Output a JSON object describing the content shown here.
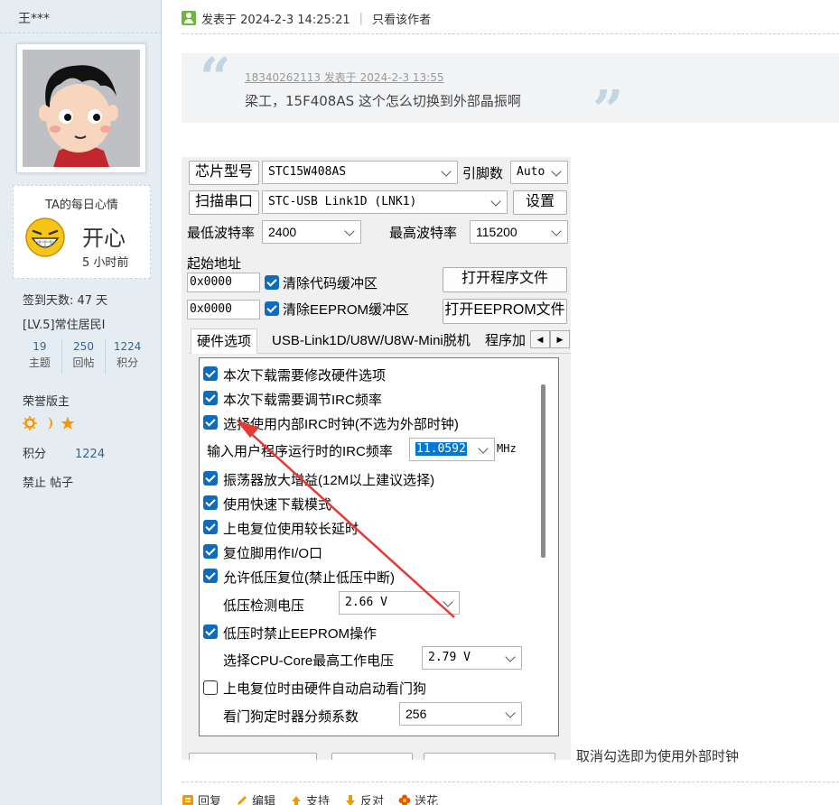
{
  "sidebar": {
    "username": "王***",
    "mood": {
      "title": "TA的每日心情",
      "text": "开心",
      "time": "5 小时前"
    },
    "signin_days": "签到天数: 47 天",
    "level": "[LV.5]常住居民I",
    "stats": [
      {
        "num": "19",
        "label": "主题"
      },
      {
        "num": "250",
        "label": "回帖"
      },
      {
        "num": "1224",
        "label": "积分"
      }
    ],
    "honor": "荣誉版主",
    "points_label": "积分",
    "points_value": "1224",
    "ban_text": "禁止 帖子"
  },
  "post": {
    "header": "发表于 2024-2-3 14:25:21",
    "only_author": "只看该作者",
    "quote": {
      "meta": "18340262113 发表于 2024-2-3 13:55",
      "text": "梁工，15F408AS  这个怎么切换到外部晶振啊"
    },
    "caption": "取消勾选即为使用外部时钟",
    "actions": [
      {
        "label": "回复",
        "icon": "reply-icon",
        "color": "#f39800"
      },
      {
        "label": "编辑",
        "icon": "edit-icon",
        "color": "#f39800"
      },
      {
        "label": "支持",
        "icon": "up-arrow-icon",
        "color": "#f39800"
      },
      {
        "label": "反对",
        "icon": "down-arrow-icon",
        "color": "#f39800"
      },
      {
        "label": "送花",
        "icon": "flower-icon",
        "color": "#e05a00"
      }
    ]
  },
  "isp": {
    "chip_btn": "芯片型号",
    "chip_value": "STC15W408AS",
    "pins_label": "引脚数",
    "pins_value": "Auto",
    "scan_btn": "扫描串口",
    "port_value": "STC-USB Link1D (LNK1)",
    "settings_btn": "设置",
    "min_baud_label": "最低波特率",
    "min_baud_value": "2400",
    "max_baud_label": "最高波特率",
    "max_baud_value": "115200",
    "start_addr_label": "起始地址",
    "addr1": "0x0000",
    "clear_code": "清除代码缓冲区",
    "open_prog_btn": "打开程序文件",
    "addr2": "0x0000",
    "clear_eeprom": "清除EEPROM缓冲区",
    "open_eeprom_btn": "打开EEPROM文件",
    "tabs": [
      "硬件选项",
      "USB-Link1D/U8W/U8W-Mini脱机",
      "程序加"
    ],
    "options": {
      "opt1": "本次下载需要修改硬件选项",
      "opt2": "本次下载需要调节IRC频率",
      "opt3": "选择使用内部IRC时钟(不选为外部时钟)",
      "irc_label": "输入用户程序运行时的IRC频率",
      "irc_value": "11.0592",
      "irc_unit": "MHz",
      "opt4": "振荡器放大增益(12M以上建议选择)",
      "opt5": "使用快速下载模式",
      "opt6": "上电复位使用较长延时",
      "opt7": "复位脚用作I/O口",
      "opt8": "允许低压复位(禁止低压中断)",
      "lv_label": "低压检测电压",
      "lv_value": "2.66 V",
      "opt9": "低压时禁止EEPROM操作",
      "cpu_label": "选择CPU-Core最高工作电压",
      "cpu_value": "2.79 V",
      "opt10": "上电复位时由硬件自动启动看门狗",
      "wdt_label": "看门狗定时器分频系数",
      "wdt_value": "256"
    }
  }
}
